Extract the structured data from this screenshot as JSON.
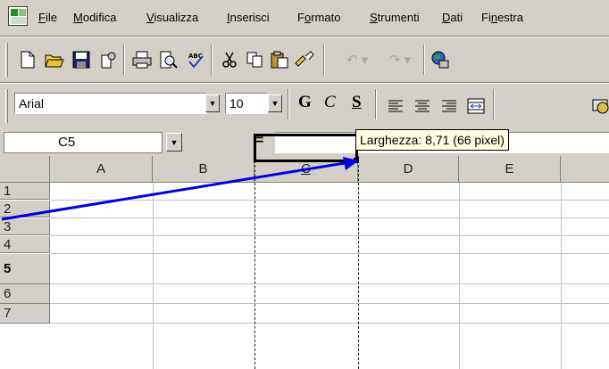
{
  "menu": {
    "items": [
      {
        "label": "File",
        "underline": "F",
        "rest": "ile"
      },
      {
        "label": "Modifica",
        "underline": "M",
        "rest": "odifica"
      },
      {
        "label": "Visualizza",
        "underline": "V",
        "rest": "isualizza"
      },
      {
        "label": "Inserisci",
        "underline": "I",
        "rest": "nserisci"
      },
      {
        "label": "Formato",
        "pre": "F",
        "underline": "o",
        "rest": "rmato"
      },
      {
        "label": "Strumenti",
        "underline": "S",
        "rest": "trumenti"
      },
      {
        "label": "Dati",
        "underline": "D",
        "rest": "ati"
      },
      {
        "label": "Finestra",
        "pre": "Fi",
        "underline": "n",
        "rest": "estra"
      }
    ]
  },
  "standard_toolbar": {
    "buttons": [
      "new-icon",
      "open-icon",
      "save-icon",
      "permission-icon",
      "print-icon",
      "print-preview-icon",
      "spelling-icon",
      "cut-icon",
      "copy-icon",
      "paste-icon",
      "format-painter-icon",
      "undo-icon",
      "redo-icon",
      "web-icon"
    ]
  },
  "formatting_toolbar": {
    "font_name": "Arial",
    "font_size": "10",
    "bold": "G",
    "italic": "C",
    "underline": "S"
  },
  "formula_bar": {
    "name_box": "C5",
    "equals": "=",
    "formula": ""
  },
  "tooltip": {
    "text": "Larghezza: 8,71 (66 pixel)"
  },
  "grid": {
    "columns": [
      "A",
      "B",
      "C",
      "D",
      "E"
    ],
    "rows": [
      "1",
      "2",
      "3",
      "4",
      "5",
      "6",
      "7"
    ],
    "active_cell": "C5",
    "active_row": "5"
  },
  "colors": {
    "chrome": "#d4d0c8",
    "annotation_arrow": "#0000e0",
    "tooltip_bg": "#ffffe1"
  }
}
